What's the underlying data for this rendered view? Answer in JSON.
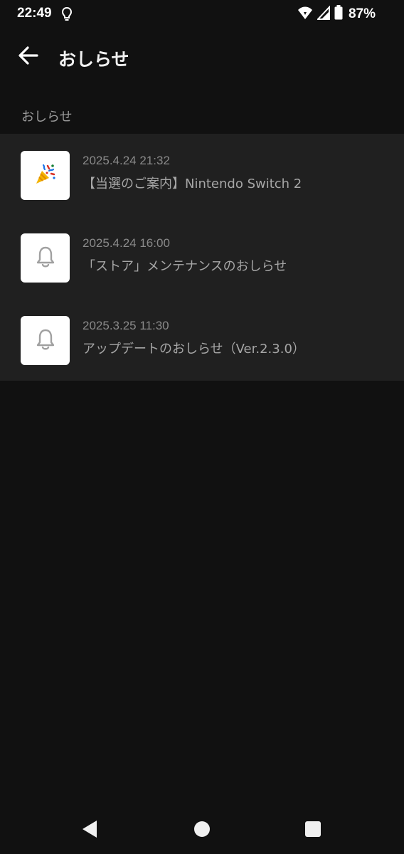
{
  "status_bar": {
    "time": "22:49",
    "battery": "87%",
    "icons": [
      "lightbulb-icon",
      "wifi-icon",
      "signal-icon",
      "battery-icon"
    ]
  },
  "app_bar": {
    "title": "おしらせ",
    "back_icon": "arrow-left-icon"
  },
  "section": {
    "title": "おしらせ"
  },
  "notifications": [
    {
      "date": "2025.4.24 21:32",
      "title": "【当選のご案内】Nintendo Switch 2",
      "icon": "party-popper-icon"
    },
    {
      "date": "2025.4.24 16:00",
      "title": "「ストア」メンテナンスのおしらせ",
      "icon": "bell-icon"
    },
    {
      "date": "2025.3.25 11:30",
      "title": "アップデートのおしらせ（Ver.2.3.0）",
      "icon": "bell-icon"
    }
  ],
  "nav_bar": {
    "icons": [
      "back-triangle-icon",
      "home-circle-icon",
      "recents-square-icon"
    ]
  },
  "colors": {
    "background": "#111111",
    "list_background": "#202020",
    "date_text": "#8a8a8a",
    "title_text": "#a6a6a6",
    "section_text": "#9a9a9a"
  }
}
